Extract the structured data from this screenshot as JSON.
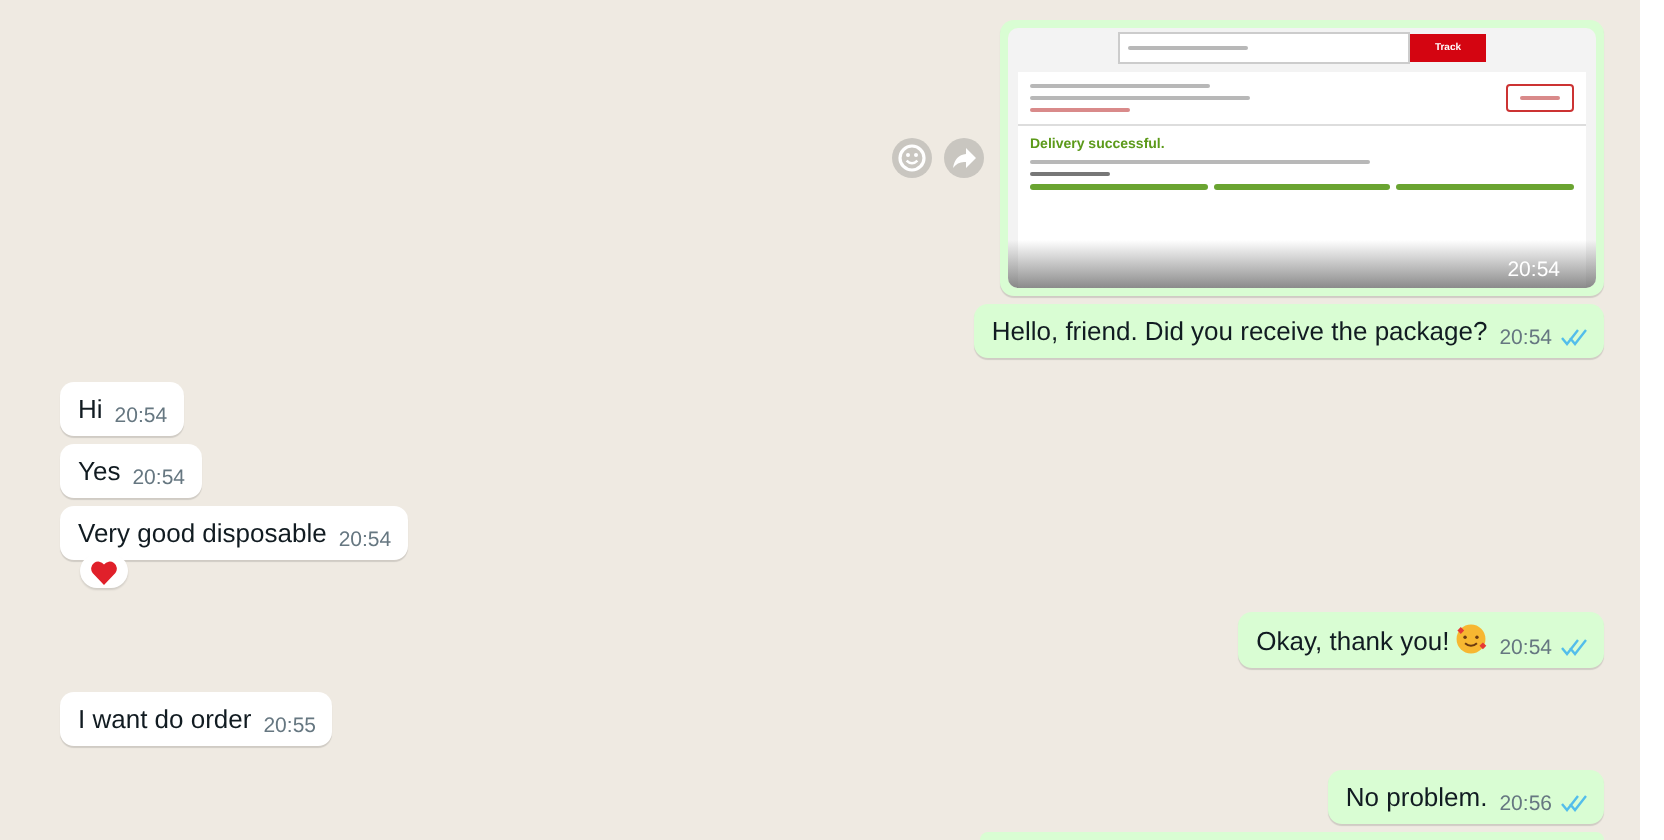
{
  "messages": [
    {
      "kind": "image",
      "outgoing": true,
      "track_button": "Track",
      "status": "Delivery successful.",
      "time": "20:54"
    },
    {
      "kind": "text",
      "outgoing": true,
      "text": "Hello, friend. Did you receive the package?",
      "time": "20:54",
      "read": true
    },
    {
      "kind": "text",
      "outgoing": false,
      "text": "Hi",
      "time": "20:54"
    },
    {
      "kind": "text",
      "outgoing": false,
      "text": "Yes",
      "time": "20:54"
    },
    {
      "kind": "text",
      "outgoing": false,
      "text": "Very good disposable",
      "time": "20:54",
      "reaction": true
    },
    {
      "kind": "text",
      "outgoing": true,
      "text": "Okay, thank you!",
      "time": "20:54",
      "read": true,
      "emoji": true
    },
    {
      "kind": "text",
      "outgoing": false,
      "text": "I want do order",
      "time": "20:55"
    },
    {
      "kind": "text",
      "outgoing": true,
      "text": "No problem.",
      "time": "20:56",
      "read": true
    }
  ]
}
